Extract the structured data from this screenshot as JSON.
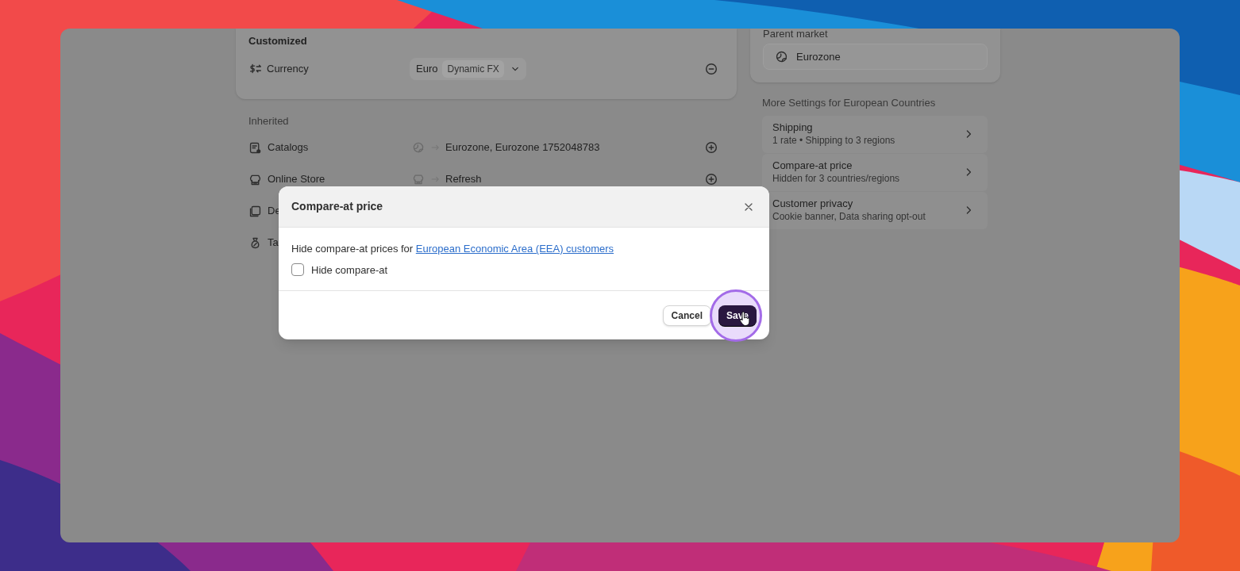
{
  "customized": {
    "heading": "Customized",
    "rows": [
      {
        "label": "Currency",
        "value": "Euro",
        "tag": "Dynamic FX"
      }
    ]
  },
  "inherited": {
    "heading": "Inherited",
    "rows": [
      {
        "label": "Catalogs",
        "value": "Eurozone, Eurozone 1752048783"
      },
      {
        "label": "Online Store",
        "value": "Refresh"
      },
      {
        "label": "De"
      },
      {
        "label": "Ta"
      }
    ]
  },
  "parent_market": {
    "label": "Parent market",
    "value": "Eurozone"
  },
  "more_settings": {
    "heading": "More Settings for European Countries",
    "items": [
      {
        "title": "Shipping",
        "subtitle": "1 rate • Shipping to 3 regions"
      },
      {
        "title": "Compare-at price",
        "subtitle": "Hidden for 3 countries/regions"
      },
      {
        "title": "Customer privacy",
        "subtitle": "Cookie banner, Data sharing opt-out"
      }
    ]
  },
  "dialog": {
    "title": "Compare-at price",
    "text": "Hide compare-at prices for ",
    "link": "European Economic Area (EEA) customers",
    "checkbox": {
      "label": "Hide compare-at",
      "checked": false
    },
    "buttons": [
      {
        "label": "Cancel",
        "kind": "secondary"
      },
      {
        "label": "Save",
        "kind": "primary",
        "highlighted": true
      }
    ]
  }
}
